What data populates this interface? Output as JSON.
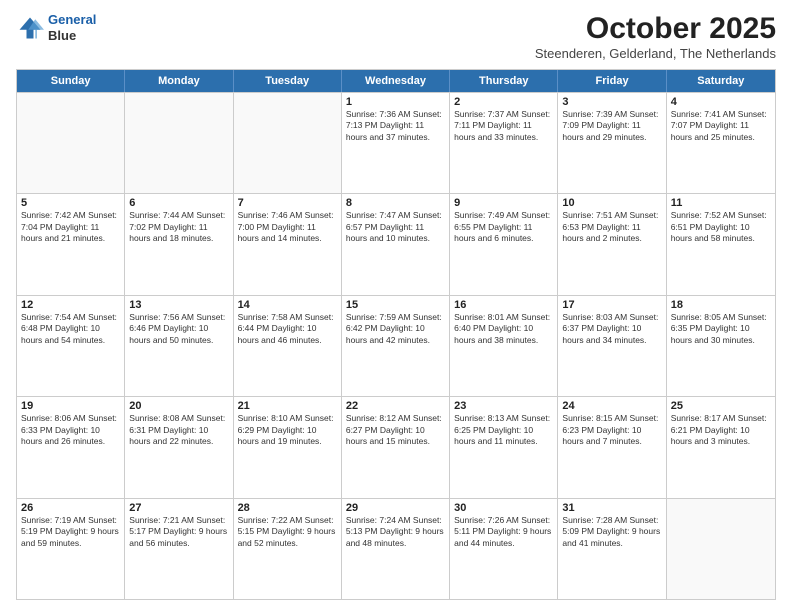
{
  "logo": {
    "line1": "General",
    "line2": "Blue"
  },
  "header": {
    "title": "October 2025",
    "subtitle": "Steenderen, Gelderland, The Netherlands"
  },
  "weekdays": [
    "Sunday",
    "Monday",
    "Tuesday",
    "Wednesday",
    "Thursday",
    "Friday",
    "Saturday"
  ],
  "rows": [
    [
      {
        "day": "",
        "info": ""
      },
      {
        "day": "",
        "info": ""
      },
      {
        "day": "",
        "info": ""
      },
      {
        "day": "1",
        "info": "Sunrise: 7:36 AM\nSunset: 7:13 PM\nDaylight: 11 hours\nand 37 minutes."
      },
      {
        "day": "2",
        "info": "Sunrise: 7:37 AM\nSunset: 7:11 PM\nDaylight: 11 hours\nand 33 minutes."
      },
      {
        "day": "3",
        "info": "Sunrise: 7:39 AM\nSunset: 7:09 PM\nDaylight: 11 hours\nand 29 minutes."
      },
      {
        "day": "4",
        "info": "Sunrise: 7:41 AM\nSunset: 7:07 PM\nDaylight: 11 hours\nand 25 minutes."
      }
    ],
    [
      {
        "day": "5",
        "info": "Sunrise: 7:42 AM\nSunset: 7:04 PM\nDaylight: 11 hours\nand 21 minutes."
      },
      {
        "day": "6",
        "info": "Sunrise: 7:44 AM\nSunset: 7:02 PM\nDaylight: 11 hours\nand 18 minutes."
      },
      {
        "day": "7",
        "info": "Sunrise: 7:46 AM\nSunset: 7:00 PM\nDaylight: 11 hours\nand 14 minutes."
      },
      {
        "day": "8",
        "info": "Sunrise: 7:47 AM\nSunset: 6:57 PM\nDaylight: 11 hours\nand 10 minutes."
      },
      {
        "day": "9",
        "info": "Sunrise: 7:49 AM\nSunset: 6:55 PM\nDaylight: 11 hours\nand 6 minutes."
      },
      {
        "day": "10",
        "info": "Sunrise: 7:51 AM\nSunset: 6:53 PM\nDaylight: 11 hours\nand 2 minutes."
      },
      {
        "day": "11",
        "info": "Sunrise: 7:52 AM\nSunset: 6:51 PM\nDaylight: 10 hours\nand 58 minutes."
      }
    ],
    [
      {
        "day": "12",
        "info": "Sunrise: 7:54 AM\nSunset: 6:48 PM\nDaylight: 10 hours\nand 54 minutes."
      },
      {
        "day": "13",
        "info": "Sunrise: 7:56 AM\nSunset: 6:46 PM\nDaylight: 10 hours\nand 50 minutes."
      },
      {
        "day": "14",
        "info": "Sunrise: 7:58 AM\nSunset: 6:44 PM\nDaylight: 10 hours\nand 46 minutes."
      },
      {
        "day": "15",
        "info": "Sunrise: 7:59 AM\nSunset: 6:42 PM\nDaylight: 10 hours\nand 42 minutes."
      },
      {
        "day": "16",
        "info": "Sunrise: 8:01 AM\nSunset: 6:40 PM\nDaylight: 10 hours\nand 38 minutes."
      },
      {
        "day": "17",
        "info": "Sunrise: 8:03 AM\nSunset: 6:37 PM\nDaylight: 10 hours\nand 34 minutes."
      },
      {
        "day": "18",
        "info": "Sunrise: 8:05 AM\nSunset: 6:35 PM\nDaylight: 10 hours\nand 30 minutes."
      }
    ],
    [
      {
        "day": "19",
        "info": "Sunrise: 8:06 AM\nSunset: 6:33 PM\nDaylight: 10 hours\nand 26 minutes."
      },
      {
        "day": "20",
        "info": "Sunrise: 8:08 AM\nSunset: 6:31 PM\nDaylight: 10 hours\nand 22 minutes."
      },
      {
        "day": "21",
        "info": "Sunrise: 8:10 AM\nSunset: 6:29 PM\nDaylight: 10 hours\nand 19 minutes."
      },
      {
        "day": "22",
        "info": "Sunrise: 8:12 AM\nSunset: 6:27 PM\nDaylight: 10 hours\nand 15 minutes."
      },
      {
        "day": "23",
        "info": "Sunrise: 8:13 AM\nSunset: 6:25 PM\nDaylight: 10 hours\nand 11 minutes."
      },
      {
        "day": "24",
        "info": "Sunrise: 8:15 AM\nSunset: 6:23 PM\nDaylight: 10 hours\nand 7 minutes."
      },
      {
        "day": "25",
        "info": "Sunrise: 8:17 AM\nSunset: 6:21 PM\nDaylight: 10 hours\nand 3 minutes."
      }
    ],
    [
      {
        "day": "26",
        "info": "Sunrise: 7:19 AM\nSunset: 5:19 PM\nDaylight: 9 hours\nand 59 minutes."
      },
      {
        "day": "27",
        "info": "Sunrise: 7:21 AM\nSunset: 5:17 PM\nDaylight: 9 hours\nand 56 minutes."
      },
      {
        "day": "28",
        "info": "Sunrise: 7:22 AM\nSunset: 5:15 PM\nDaylight: 9 hours\nand 52 minutes."
      },
      {
        "day": "29",
        "info": "Sunrise: 7:24 AM\nSunset: 5:13 PM\nDaylight: 9 hours\nand 48 minutes."
      },
      {
        "day": "30",
        "info": "Sunrise: 7:26 AM\nSunset: 5:11 PM\nDaylight: 9 hours\nand 44 minutes."
      },
      {
        "day": "31",
        "info": "Sunrise: 7:28 AM\nSunset: 5:09 PM\nDaylight: 9 hours\nand 41 minutes."
      },
      {
        "day": "",
        "info": ""
      }
    ]
  ]
}
